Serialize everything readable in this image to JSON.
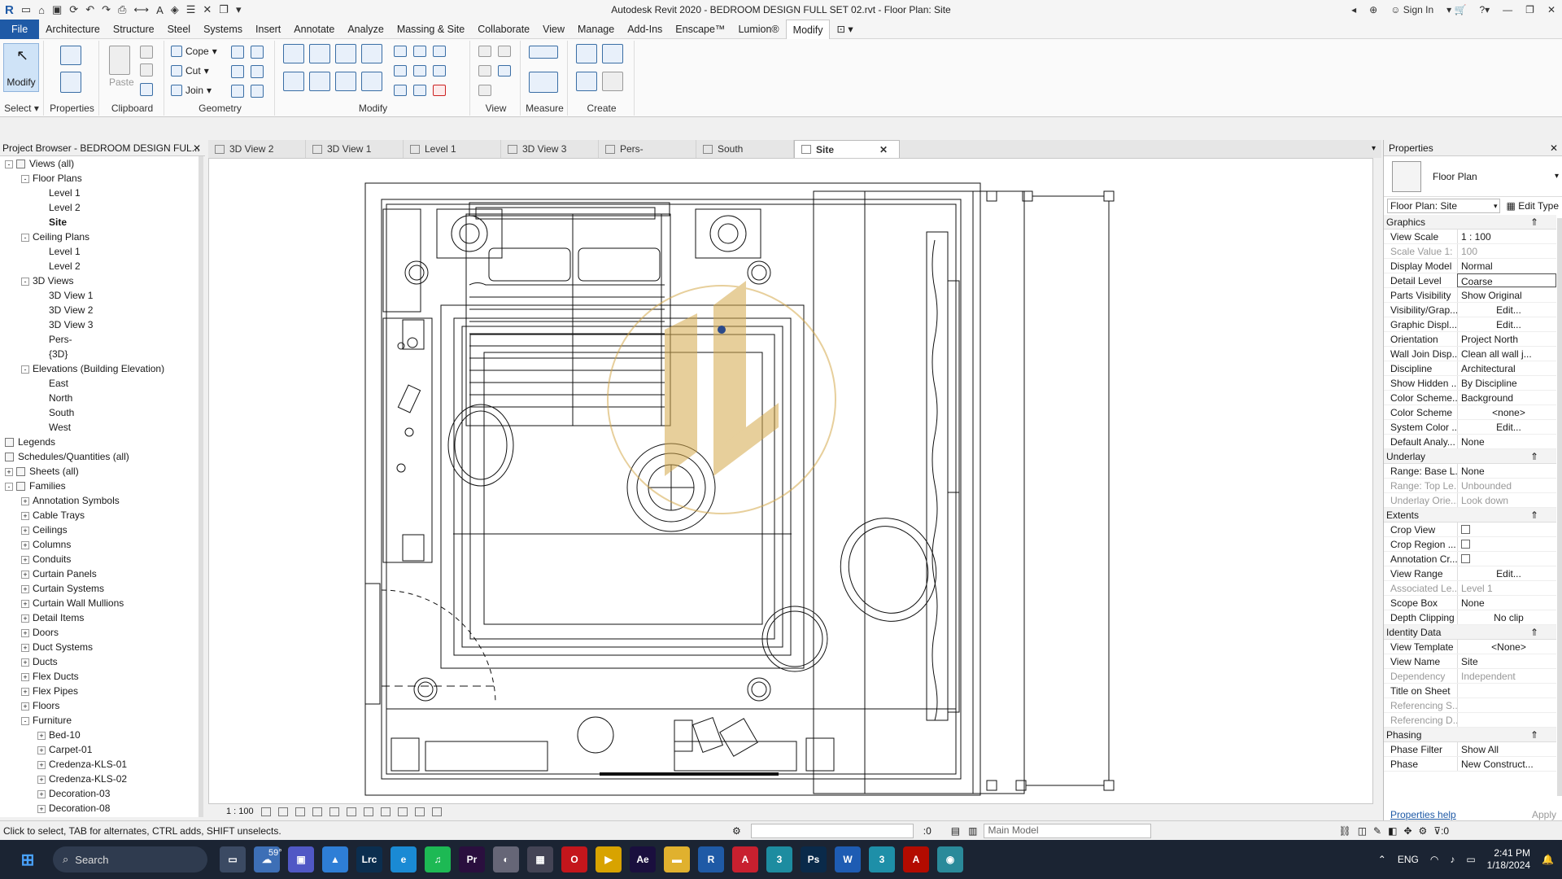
{
  "app": {
    "title": "Autodesk Revit 2020 - BEDROOM DESIGN FULL SET 02.rvt - Floor Plan: Site",
    "sign_in": "Sign In"
  },
  "menu": [
    "File",
    "Architecture",
    "Structure",
    "Steel",
    "Systems",
    "Insert",
    "Annotate",
    "Analyze",
    "Massing & Site",
    "Collaborate",
    "View",
    "Manage",
    "Add-Ins",
    "Enscape™",
    "Lumion®",
    "Modify"
  ],
  "ribbon": {
    "select_label": "Select ▾",
    "modify_label": "Modify",
    "properties_label": "Properties",
    "clipboard_label": "Clipboard",
    "paste_label": "Paste",
    "cope": "Cope",
    "cut": "Cut",
    "join": "Join",
    "geometry_label": "Geometry",
    "modify_group_label": "Modify",
    "view_label": "View",
    "measure_label": "Measure",
    "create_label": "Create"
  },
  "project_browser": {
    "title": "Project Browser - BEDROOM DESIGN FUL...",
    "items": [
      {
        "label": "Views (all)",
        "level": 0,
        "toggle": "-"
      },
      {
        "label": "Floor Plans",
        "level": 1,
        "toggle": "-"
      },
      {
        "label": "Level 1",
        "level": 2
      },
      {
        "label": "Level 2",
        "level": 2
      },
      {
        "label": "Site",
        "level": 2,
        "selected": true
      },
      {
        "label": "Ceiling Plans",
        "level": 1,
        "toggle": "-"
      },
      {
        "label": "Level 1",
        "level": 2
      },
      {
        "label": "Level 2",
        "level": 2
      },
      {
        "label": "3D Views",
        "level": 1,
        "toggle": "-"
      },
      {
        "label": "3D View 1",
        "level": 2
      },
      {
        "label": "3D View 2",
        "level": 2
      },
      {
        "label": "3D View 3",
        "level": 2
      },
      {
        "label": "Pers-",
        "level": 2
      },
      {
        "label": "{3D}",
        "level": 2
      },
      {
        "label": "Elevations (Building Elevation)",
        "level": 1,
        "toggle": "-"
      },
      {
        "label": "East",
        "level": 2
      },
      {
        "label": "North",
        "level": 2
      },
      {
        "label": "South",
        "level": 2
      },
      {
        "label": "West",
        "level": 2
      },
      {
        "label": "Legends",
        "level": 0,
        "icon": true
      },
      {
        "label": "Schedules/Quantities (all)",
        "level": 0,
        "icon": true
      },
      {
        "label": "Sheets (all)",
        "level": 0,
        "toggle": "+",
        "icon": true
      },
      {
        "label": "Families",
        "level": 0,
        "toggle": "-",
        "icon": true
      },
      {
        "label": "Annotation Symbols",
        "level": 1,
        "toggle": "+"
      },
      {
        "label": "Cable Trays",
        "level": 1,
        "toggle": "+"
      },
      {
        "label": "Ceilings",
        "level": 1,
        "toggle": "+"
      },
      {
        "label": "Columns",
        "level": 1,
        "toggle": "+"
      },
      {
        "label": "Conduits",
        "level": 1,
        "toggle": "+"
      },
      {
        "label": "Curtain Panels",
        "level": 1,
        "toggle": "+"
      },
      {
        "label": "Curtain Systems",
        "level": 1,
        "toggle": "+"
      },
      {
        "label": "Curtain Wall Mullions",
        "level": 1,
        "toggle": "+"
      },
      {
        "label": "Detail Items",
        "level": 1,
        "toggle": "+"
      },
      {
        "label": "Doors",
        "level": 1,
        "toggle": "+"
      },
      {
        "label": "Duct Systems",
        "level": 1,
        "toggle": "+"
      },
      {
        "label": "Ducts",
        "level": 1,
        "toggle": "+"
      },
      {
        "label": "Flex Ducts",
        "level": 1,
        "toggle": "+"
      },
      {
        "label": "Flex Pipes",
        "level": 1,
        "toggle": "+"
      },
      {
        "label": "Floors",
        "level": 1,
        "toggle": "+"
      },
      {
        "label": "Furniture",
        "level": 1,
        "toggle": "-"
      },
      {
        "label": "Bed-10",
        "level": 2,
        "toggle": "+"
      },
      {
        "label": "Carpet-01",
        "level": 2,
        "toggle": "+"
      },
      {
        "label": "Credenza-KLS-01",
        "level": 2,
        "toggle": "+"
      },
      {
        "label": "Credenza-KLS-02",
        "level": 2,
        "toggle": "+"
      },
      {
        "label": "Decoration-03",
        "level": 2,
        "toggle": "+"
      },
      {
        "label": "Decoration-08",
        "level": 2,
        "toggle": "+"
      }
    ]
  },
  "tabs": [
    {
      "label": "3D View 2",
      "icon": "3d-view-icon"
    },
    {
      "label": "3D View 1",
      "icon": "3d-view-icon"
    },
    {
      "label": "Level 1",
      "icon": "floor-plan-icon"
    },
    {
      "label": "3D View 3",
      "icon": "3d-view-icon"
    },
    {
      "label": "Pers-",
      "icon": "3d-view-icon"
    },
    {
      "label": "South",
      "icon": "elevation-icon"
    },
    {
      "label": "Site",
      "icon": "floor-plan-icon",
      "active": true,
      "close": "✕"
    }
  ],
  "view_control": {
    "scale": "1 : 100"
  },
  "properties": {
    "title": "Properties",
    "type_name": "Floor Plan",
    "instance": "Floor Plan: Site",
    "edit_type": "Edit Type",
    "sections": [
      {
        "name": "Graphics",
        "rows": [
          {
            "k": "View Scale",
            "v": "1 : 100"
          },
          {
            "k": "Scale Value    1:",
            "v": "100",
            "dim": true
          },
          {
            "k": "Display Model",
            "v": "Normal"
          },
          {
            "k": "Detail Level",
            "v": "Coarse",
            "boxed": true
          },
          {
            "k": "Parts Visibility",
            "v": "Show Original"
          },
          {
            "k": "Visibility/Grap...",
            "v": "Edit...",
            "center": true
          },
          {
            "k": "Graphic Displ...",
            "v": "Edit...",
            "center": true
          },
          {
            "k": "Orientation",
            "v": "Project North"
          },
          {
            "k": "Wall Join Disp...",
            "v": "Clean all wall j..."
          },
          {
            "k": "Discipline",
            "v": "Architectural"
          },
          {
            "k": "Show Hidden ...",
            "v": "By Discipline"
          },
          {
            "k": "Color Scheme...",
            "v": "Background"
          },
          {
            "k": "Color Scheme",
            "v": "<none>",
            "center": true
          },
          {
            "k": "System Color ...",
            "v": "Edit...",
            "center": true
          },
          {
            "k": "Default Analy...",
            "v": "None"
          }
        ]
      },
      {
        "name": "Underlay",
        "rows": [
          {
            "k": "Range: Base L...",
            "v": "None"
          },
          {
            "k": "Range: Top Le...",
            "v": "Unbounded",
            "dim": true
          },
          {
            "k": "Underlay Orie...",
            "v": "Look down",
            "dim": true
          }
        ]
      },
      {
        "name": "Extents",
        "rows": [
          {
            "k": "Crop View",
            "v": "",
            "check": true
          },
          {
            "k": "Crop Region ...",
            "v": "",
            "check": true
          },
          {
            "k": "Annotation Cr...",
            "v": "",
            "check": true
          },
          {
            "k": "View Range",
            "v": "Edit...",
            "center": true
          },
          {
            "k": "Associated Le...",
            "v": "Level 1",
            "dim": true
          },
          {
            "k": "Scope Box",
            "v": "None"
          },
          {
            "k": "Depth Clipping",
            "v": "No clip",
            "center": true
          }
        ]
      },
      {
        "name": "Identity Data",
        "rows": [
          {
            "k": "View Template",
            "v": "<None>",
            "center": true
          },
          {
            "k": "View Name",
            "v": "Site"
          },
          {
            "k": "Dependency",
            "v": "Independent",
            "dim": true
          },
          {
            "k": "Title on Sheet",
            "v": ""
          },
          {
            "k": "Referencing S...",
            "v": "",
            "dim": true
          },
          {
            "k": "Referencing D...",
            "v": "",
            "dim": true
          }
        ]
      },
      {
        "name": "Phasing",
        "rows": [
          {
            "k": "Phase Filter",
            "v": "Show All"
          },
          {
            "k": "Phase",
            "v": "New Construct..."
          }
        ]
      }
    ],
    "help": "Properties help",
    "apply": "Apply"
  },
  "status": {
    "hint": "Click to select, TAB for alternates, CTRL adds, SHIFT unselects.",
    "count": ":0",
    "model": "Main Model",
    "filter": ":0"
  },
  "taskbar": {
    "search": "Search",
    "weather": "59°",
    "lang": "ENG",
    "time": "2:41 PM",
    "date": "1/18/2024",
    "apps": [
      {
        "name": "task-view-icon",
        "label": "▭",
        "color": "#3b4a63"
      },
      {
        "name": "cloud-app-icon",
        "label": "☁",
        "color": "#3d6fb6"
      },
      {
        "name": "teams-icon",
        "label": "▣",
        "color": "#5058c5"
      },
      {
        "name": "photos-icon",
        "label": "▲",
        "color": "#2e7ed6"
      },
      {
        "name": "lightroom-classic-icon",
        "label": "Lrc",
        "color": "#0b2e4f"
      },
      {
        "name": "edge-icon",
        "label": "e",
        "color": "#1a8ad4"
      },
      {
        "name": "spotify-icon",
        "label": "♫",
        "color": "#1db954"
      },
      {
        "name": "premiere-icon",
        "label": "Pr",
        "color": "#2a0f3e"
      },
      {
        "name": "globe-app-icon",
        "label": "◐",
        "color": "#667"
      },
      {
        "name": "calculator-icon",
        "label": "▦",
        "color": "#445"
      },
      {
        "name": "opera-icon",
        "label": "O",
        "color": "#c4161c"
      },
      {
        "name": "media-player-icon",
        "label": "▶",
        "color": "#d8a300"
      },
      {
        "name": "after-effects-icon",
        "label": "Ae",
        "color": "#1a0f3e"
      },
      {
        "name": "file-explorer-icon",
        "label": "▬",
        "color": "#e0b12e"
      },
      {
        "name": "revit-icon",
        "label": "R",
        "color": "#1f5aa6"
      },
      {
        "name": "autocad-icon",
        "label": "A",
        "color": "#c8202f"
      },
      {
        "name": "app-3ds-icon",
        "label": "3",
        "color": "#1d8ca0"
      },
      {
        "name": "photoshop-icon",
        "label": "Ps",
        "color": "#0a2a4a"
      },
      {
        "name": "word-icon",
        "label": "W",
        "color": "#1e5cb3"
      },
      {
        "name": "app-3-icon",
        "label": "3",
        "color": "#1e8fa8"
      },
      {
        "name": "acrobat-icon",
        "label": "A",
        "color": "#b30b00"
      },
      {
        "name": "globe-icon",
        "label": "◉",
        "color": "#2a8a9a"
      }
    ]
  },
  "colors": {
    "accent": "#1f5aa6",
    "watermark": "#d4a84a",
    "taskbar": "#1b2433"
  }
}
